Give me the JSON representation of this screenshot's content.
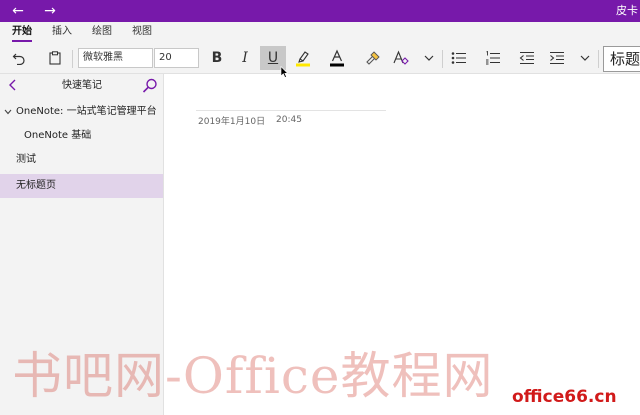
{
  "titlebar": {
    "back_label": "←",
    "forward_label": "→",
    "app_title": "皮卡",
    "accent_color": "#7719aa"
  },
  "ribbon_tabs": [
    "开始",
    "插入",
    "绘图",
    "视图"
  ],
  "toolbar": {
    "undo_icon": "undo-icon",
    "paste_icon": "clipboard-icon",
    "font_name": "微软雅黑",
    "font_size": "20",
    "bold_label": "B",
    "italic_label": "I",
    "underline_label": "U",
    "underline_pressed": true,
    "highlight_color": "#ffe800",
    "font_color_label": "A",
    "font_color": "#000000",
    "style_label": "标题"
  },
  "navigation": {
    "notebook_name": "快速笔记",
    "items": [
      {
        "label": "OneNote: 一站式笔记管理平台",
        "level": 0,
        "expanded": true
      },
      {
        "label": "OneNote 基础",
        "level": 1
      },
      {
        "label": "测试",
        "level": 0
      },
      {
        "label": "无标题页",
        "level": 0,
        "selected": true
      }
    ]
  },
  "page": {
    "date": "2019年1月10日",
    "time": "20:45"
  },
  "watermark": {
    "text": "书吧网-Office教程网",
    "logo": "office66.cn"
  }
}
